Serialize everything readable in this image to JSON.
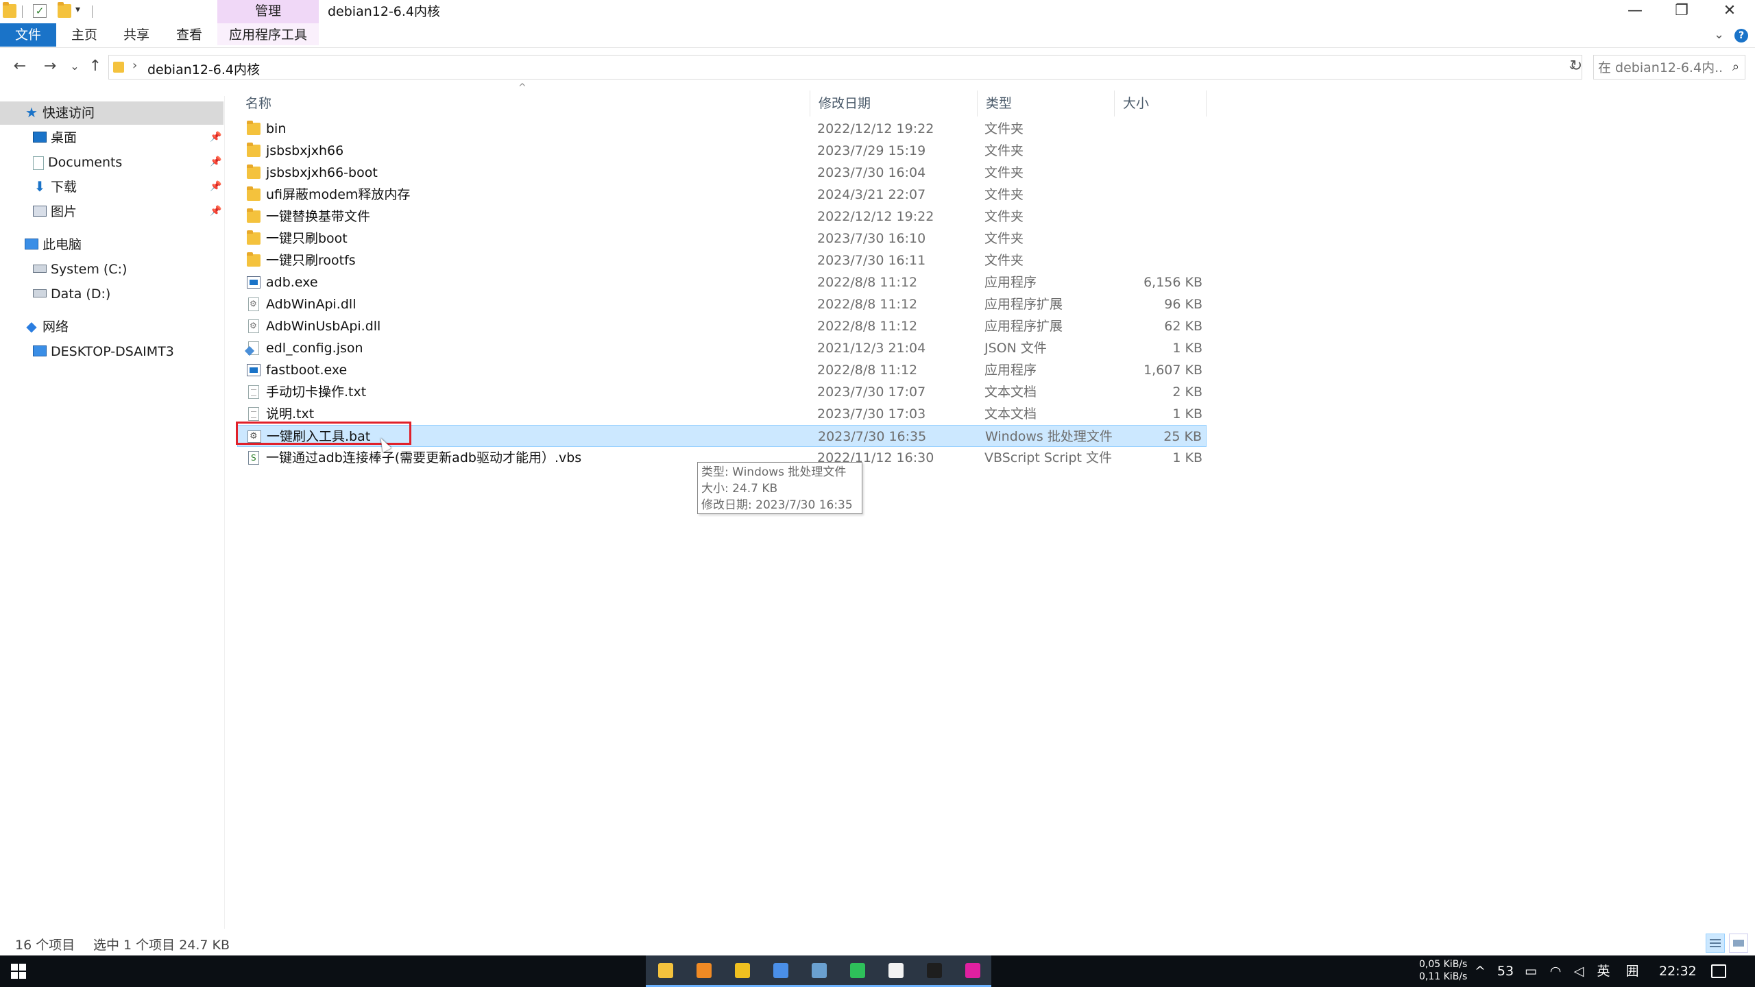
{
  "window": {
    "title": "debian12-6.4内核",
    "manage_tab": "管理",
    "controls": {
      "minimize": "—",
      "restore": "❐",
      "close": "✕"
    }
  },
  "ribbon": {
    "tabs": [
      {
        "label": "文件"
      },
      {
        "label": "主页"
      },
      {
        "label": "共享"
      },
      {
        "label": "查看"
      },
      {
        "label": "应用程序工具"
      }
    ],
    "expand_icon": "⌄",
    "help_icon": "?"
  },
  "address_bar": {
    "back": "←",
    "forward": "→",
    "recent": "⌄",
    "up": "↑",
    "separator": "›",
    "path": "debian12-6.4内核",
    "dropdown": "⌄",
    "refresh": "↻"
  },
  "search": {
    "placeholder": "在 debian12-6.4内...",
    "icon": "⌕"
  },
  "nav_pane": {
    "quick_access": "快速访问",
    "items": [
      {
        "label": "桌面",
        "pinned": true
      },
      {
        "label": "Documents",
        "pinned": true
      },
      {
        "label": "下载",
        "pinned": true
      },
      {
        "label": "图片",
        "pinned": true
      }
    ],
    "this_pc": "此电脑",
    "drives": [
      {
        "label": "System (C:)"
      },
      {
        "label": "Data (D:)"
      }
    ],
    "network": "网络",
    "network_items": [
      {
        "label": "DESKTOP-DSAIMT3"
      }
    ],
    "pin_glyph": "📌"
  },
  "columns": {
    "name": "名称",
    "date": "修改日期",
    "type": "类型",
    "size": "大小",
    "sort_glyph": "^"
  },
  "files": [
    {
      "name": "bin",
      "date": "2022/12/12 19:22",
      "type": "文件夹",
      "size": "",
      "icon": "folder-icon"
    },
    {
      "name": "jsbsbxjxh66",
      "date": "2023/7/29 15:19",
      "type": "文件夹",
      "size": "",
      "icon": "folder-icon"
    },
    {
      "name": "jsbsbxjxh66-boot",
      "date": "2023/7/30 16:04",
      "type": "文件夹",
      "size": "",
      "icon": "folder-icon"
    },
    {
      "name": "ufi屏蔽modem释放内存",
      "date": "2024/3/21 22:07",
      "type": "文件夹",
      "size": "",
      "icon": "folder-icon"
    },
    {
      "name": "一键替换基带文件",
      "date": "2022/12/12 19:22",
      "type": "文件夹",
      "size": "",
      "icon": "folder-icon"
    },
    {
      "name": "一键只刷boot",
      "date": "2023/7/30 16:10",
      "type": "文件夹",
      "size": "",
      "icon": "folder-icon"
    },
    {
      "name": "一键只刷rootfs",
      "date": "2023/7/30 16:11",
      "type": "文件夹",
      "size": "",
      "icon": "folder-icon"
    },
    {
      "name": "adb.exe",
      "date": "2022/8/8 11:12",
      "type": "应用程序",
      "size": "6,156 KB",
      "icon": "exe-icon"
    },
    {
      "name": "AdbWinApi.dll",
      "date": "2022/8/8 11:12",
      "type": "应用程序扩展",
      "size": "96 KB",
      "icon": "dll-icon"
    },
    {
      "name": "AdbWinUsbApi.dll",
      "date": "2022/8/8 11:12",
      "type": "应用程序扩展",
      "size": "62 KB",
      "icon": "dll-icon"
    },
    {
      "name": "edl_config.json",
      "date": "2021/12/3 21:04",
      "type": "JSON 文件",
      "size": "1 KB",
      "icon": "json-icon"
    },
    {
      "name": "fastboot.exe",
      "date": "2022/8/8 11:12",
      "type": "应用程序",
      "size": "1,607 KB",
      "icon": "exe-icon"
    },
    {
      "name": "手动切卡操作.txt",
      "date": "2023/7/30 17:07",
      "type": "文本文档",
      "size": "2 KB",
      "icon": "txt-icon"
    },
    {
      "name": "说明.txt",
      "date": "2023/7/30 17:03",
      "type": "文本文档",
      "size": "1 KB",
      "icon": "txt-icon"
    },
    {
      "name": "一键刷入工具.bat",
      "date": "2023/7/30 16:35",
      "type": "Windows 批处理文件",
      "size": "25 KB",
      "icon": "bat-icon",
      "selected": true
    },
    {
      "name": "一键通过adb连接棒子(需要更新adb驱动才能用）.vbs",
      "date": "2022/11/12 16:30",
      "type": "VBScript Script 文件",
      "size": "1 KB",
      "icon": "vbs-icon"
    }
  ],
  "tooltip": {
    "type_line": "类型: Windows 批处理文件",
    "size_line": "大小: 24.7 KB",
    "date_line": "修改日期: 2023/7/30 16:35"
  },
  "status": {
    "item_count": "16 个项目",
    "selection": "选中 1 个项目  24.7 KB"
  },
  "taskbar": {
    "apps": [
      {
        "name": "file-explorer",
        "color": "#f4c23d",
        "active": true
      },
      {
        "name": "sublime-text",
        "color": "#f08a24",
        "active": true
      },
      {
        "name": "git-client",
        "color": "#f0c020",
        "active": true
      },
      {
        "name": "chrome",
        "color": "#4a8fe8",
        "active": true
      },
      {
        "name": "mountain-app",
        "color": "#6aa0d0",
        "active": true
      },
      {
        "name": "wechat",
        "color": "#2ec05a",
        "active": true
      },
      {
        "name": "notepad-app",
        "color": "#f2f2f2",
        "active": true
      },
      {
        "name": "terminal",
        "color": "#1e1e1e",
        "active": true
      },
      {
        "name": "ufi-app",
        "color": "#e020a0",
        "active": true
      }
    ],
    "net_up": "0,05 KiB/s",
    "net_down": "0,11 KiB/s",
    "tray_chevron": "^",
    "temp": "53",
    "lang": "英",
    "ime": "囲",
    "time": "22:32"
  }
}
